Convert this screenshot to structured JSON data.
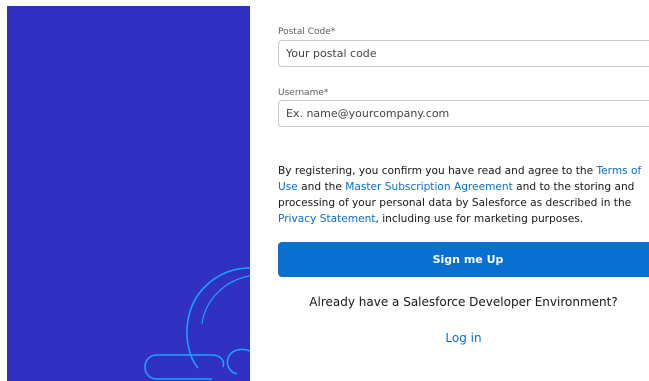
{
  "form": {
    "postal_code": {
      "label": "Postal Code*",
      "placeholder": "Your postal code",
      "value": ""
    },
    "username": {
      "label": "Username*",
      "placeholder": "Ex. name@yourcompany.com",
      "value": ""
    }
  },
  "legal": {
    "part1": "By registering, you confirm you have read and agree to the ",
    "terms_link": "Terms of Use",
    "part2": " and the ",
    "msa_link": "Master Subscription Agreement",
    "part3": " and to the storing and processing of your personal data by Salesforce as described in the ",
    "privacy_link": "Privacy Statement",
    "part4": ", including use for marketing purposes."
  },
  "signup_button": "Sign me Up",
  "existing_env_text": "Already have a Salesforce Developer Environment?",
  "login_link": "Log in",
  "colors": {
    "panel": "#3030c2",
    "button": "#0a70cf",
    "link": "#0b6ec7",
    "illustration_stroke": "#1aa6ff"
  }
}
